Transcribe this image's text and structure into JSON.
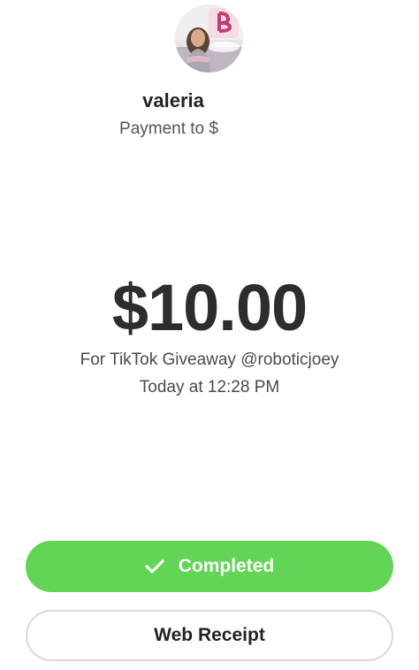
{
  "recipient": {
    "name": "valeria",
    "subtitle": "Payment to $"
  },
  "payment": {
    "amount": "$10.00",
    "note": "For TikTok Giveaway @roboticjoey",
    "time": "Today at 12:28 PM"
  },
  "actions": {
    "completed_label": "Completed",
    "receipt_label": "Web Receipt"
  },
  "colors": {
    "accent_green": "#62d456",
    "text_dark": "#2d2d2d",
    "border_gray": "#d8d8d8"
  },
  "icons": {
    "status": "checkmark-icon"
  }
}
